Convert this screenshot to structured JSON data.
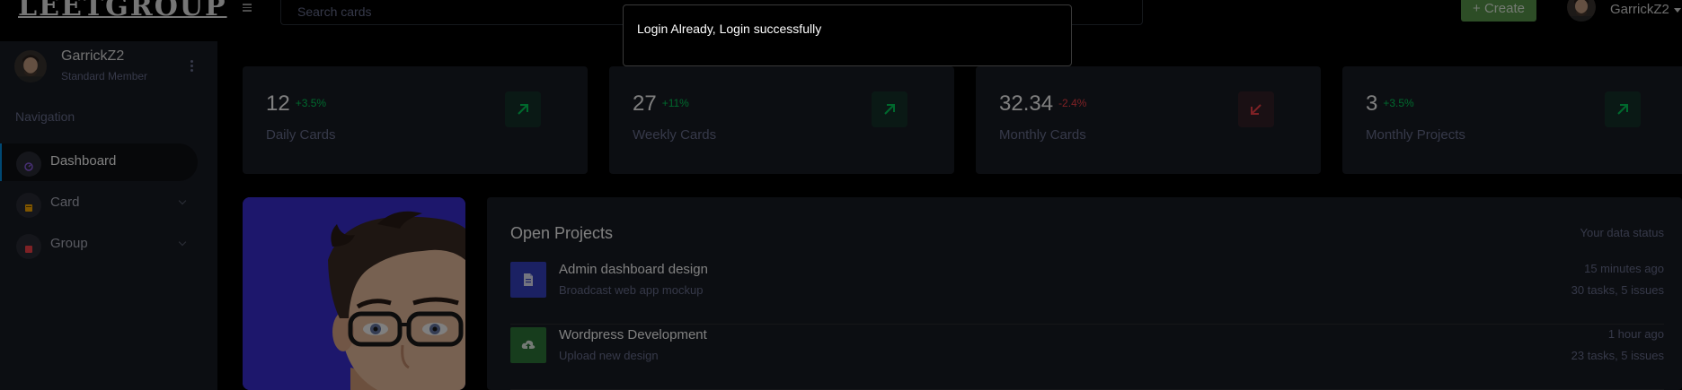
{
  "navbar": {
    "brand": "LEETGROUP",
    "search_placeholder": "Search cards",
    "create_label": "+ Create",
    "user_name": "GarrickZ2"
  },
  "sidebar": {
    "profile": {
      "name": "GarrickZ2",
      "role": "Standard Member"
    },
    "nav_heading": "Navigation",
    "items": [
      {
        "label": "Dashboard",
        "icon": "dashboard-gauge-icon",
        "active": true
      },
      {
        "label": "Card",
        "icon": "card-icon",
        "active": false
      },
      {
        "label": "Group",
        "icon": "group-icon",
        "active": false
      }
    ]
  },
  "stats": [
    {
      "value": "12",
      "change": "+3.5%",
      "trend": "up",
      "label": "Daily Cards"
    },
    {
      "value": "27",
      "change": "+11%",
      "trend": "up",
      "label": "Weekly Cards"
    },
    {
      "value": "32.34",
      "change": "-2.4%",
      "trend": "down",
      "label": "Monthly Cards"
    },
    {
      "value": "3",
      "change": "+3.5%",
      "trend": "up",
      "label": "Monthly Projects"
    }
  ],
  "projects": {
    "title": "Open Projects",
    "status_label": "Your data status",
    "rows": [
      {
        "title": "Admin dashboard design",
        "subtitle": "Broadcast web app mockup",
        "time": "15 minutes ago",
        "meta": "30 tasks, 5 issues",
        "icon": "document-icon"
      },
      {
        "title": "Wordpress Development",
        "subtitle": "Upload new design",
        "time": "1 hour ago",
        "meta": "23 tasks, 5 issues",
        "icon": "cloud-upload-icon"
      }
    ]
  },
  "toast": {
    "message": "Login Already, Login successfully"
  },
  "colors": {
    "success": "#00d25b",
    "danger": "#fc424a",
    "primary": "#0090e7",
    "card_bg": "#191c24",
    "create_button": "#5a9b4c",
    "character_bg": "#3b2ed8"
  }
}
